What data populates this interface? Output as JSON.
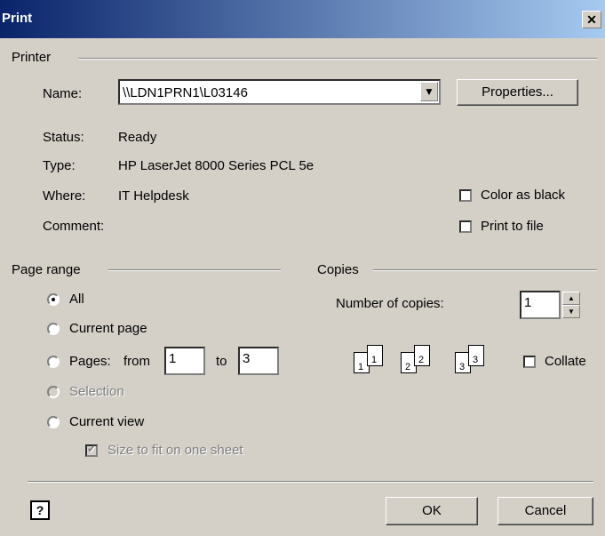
{
  "window": {
    "title": "Print",
    "close_glyph": "✕"
  },
  "printer": {
    "group_label": "Printer",
    "name_label": "Name:",
    "name_value": "\\\\LDN1PRN1\\L03146",
    "properties_button": "Properties...",
    "status_label": "Status:",
    "status_value": "Ready",
    "type_label": "Type:",
    "type_value": "HP LaserJet 8000 Series PCL 5e",
    "where_label": "Where:",
    "where_value": "IT Helpdesk",
    "comment_label": "Comment:",
    "color_as_black": "Color as black",
    "print_to_file": "Print to file"
  },
  "page_range": {
    "group_label": "Page range",
    "all": "All",
    "current_page": "Current page",
    "pages": "Pages:",
    "from_label": "from",
    "from_value": "1",
    "to_label": "to",
    "to_value": "3",
    "selection": "Selection",
    "current_view": "Current view",
    "size_to_fit": "Size to fit on one sheet"
  },
  "copies": {
    "group_label": "Copies",
    "number_label": "Number of copies:",
    "number_value": "1",
    "collate": "Collate",
    "collate_pages": [
      "1",
      "1",
      "2",
      "2",
      "3",
      "3"
    ]
  },
  "footer": {
    "ok": "OK",
    "cancel": "Cancel",
    "help_glyph": "?"
  }
}
